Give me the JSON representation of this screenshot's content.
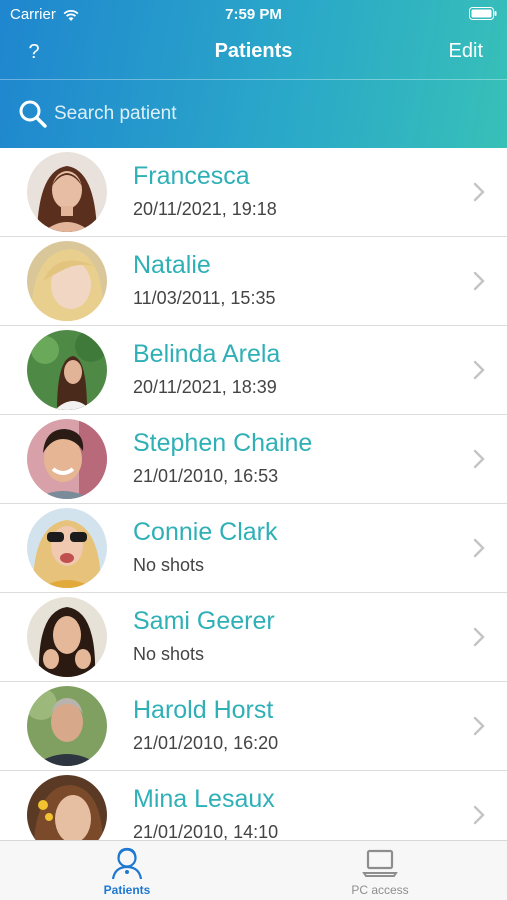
{
  "status_bar": {
    "carrier": "Carrier",
    "time": "7:59 PM",
    "icons": [
      "wifi-icon",
      "battery-icon"
    ]
  },
  "nav": {
    "help_label": "?",
    "title": "Patients",
    "edit_label": "Edit"
  },
  "search": {
    "placeholder": "Search patient",
    "value": "",
    "icon": "search-icon"
  },
  "patients": [
    {
      "name": "Francesca",
      "last_shot": "20/11/2021, 19:18"
    },
    {
      "name": "Natalie",
      "last_shot": "11/03/2011, 15:35"
    },
    {
      "name": "Belinda Arela",
      "last_shot": "20/11/2021, 18:39"
    },
    {
      "name": "Stephen Chaine",
      "last_shot": "21/01/2010, 16:53"
    },
    {
      "name": "Connie Clark",
      "last_shot": "No shots"
    },
    {
      "name": "Sami Geerer",
      "last_shot": "No shots"
    },
    {
      "name": "Harold Horst",
      "last_shot": "21/01/2010, 16:20"
    },
    {
      "name": "Mina Lesaux",
      "last_shot": "21/01/2010, 14:10"
    }
  ],
  "tabs": [
    {
      "label": "Patients",
      "icon": "patient-icon",
      "selected": true
    },
    {
      "label": "PC access",
      "icon": "laptop-icon",
      "selected": false
    }
  ],
  "colors": {
    "header_gradient_start": "#1f86cf",
    "header_gradient_end": "#37c0b8",
    "name_color": "#2fb0b7",
    "tab_active": "#1e78d0",
    "tab_inactive": "#8e8e8e"
  }
}
